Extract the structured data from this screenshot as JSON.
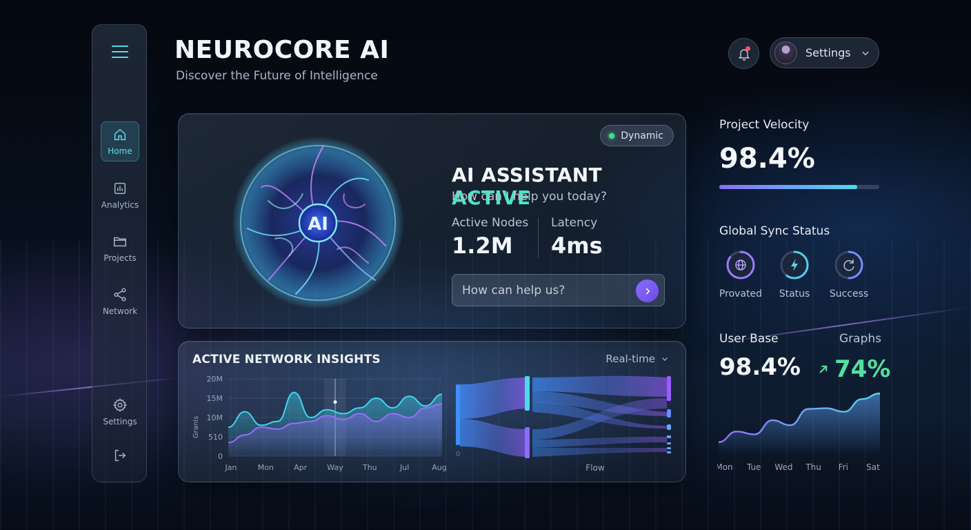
{
  "app": {
    "title": "NEUROCORE AI",
    "subtitle": "Discover the Future of Intelligence"
  },
  "sidebar": {
    "items": [
      {
        "label": "Home",
        "icon": "home-icon",
        "active": true
      },
      {
        "label": "Analytics",
        "icon": "bar-chart-icon",
        "active": false
      },
      {
        "label": "Projects",
        "icon": "folder-icon",
        "active": false
      },
      {
        "label": "Network",
        "icon": "share-nodes-icon",
        "active": false
      },
      {
        "label": "Settings",
        "icon": "gear-icon",
        "active": false
      }
    ],
    "logout_icon": "logout-icon"
  },
  "header": {
    "settings_label": "Settings",
    "bell_icon": "bell-icon",
    "has_notification": true
  },
  "ai_card": {
    "badge": "Dynamic",
    "orb_label": "AI",
    "heading_main": "AI ASSISTANT",
    "heading_accent": "ACTIVE",
    "prompt": "How can I help you today?",
    "stats": [
      {
        "label": "Active Nodes",
        "value": "1.2M"
      },
      {
        "label": "Latency",
        "value": "4ms"
      }
    ],
    "input_placeholder": "How can help us?",
    "accent_color": "#4fe3c2"
  },
  "insights": {
    "title": "ACTIVE NETWORK INSIGHTS",
    "range_label": "Real-time",
    "sankey_label": "Flow",
    "sankey_side_label": "0"
  },
  "chart_data": [
    {
      "type": "area",
      "categories": [
        "Jan",
        "Mon",
        "Apr",
        "Way",
        "Thu",
        "Jul",
        "Aug"
      ],
      "y_ticks": [
        "20M",
        "15M",
        "10M",
        "510",
        "0"
      ],
      "ylabel": "Granis",
      "ylim": [
        0,
        20
      ],
      "series": [
        {
          "values": [
            7.5,
            11.5,
            8,
            9,
            16.5,
            10,
            12,
            11,
            12.5,
            15,
            12.5,
            15.5,
            13,
            16
          ]
        },
        {
          "values": [
            3.5,
            5.5,
            7.5,
            7,
            8.5,
            9,
            10.5,
            9.5,
            11,
            9,
            11,
            10,
            12.5,
            13.5
          ]
        }
      ],
      "highlight_category": "Way",
      "grid": true
    },
    {
      "type": "area",
      "categories": [
        "Mon",
        "Tue",
        "Wed",
        "Thu",
        "Fri",
        "Sat"
      ],
      "title": "User Base",
      "series": [
        {
          "values": [
            1.5,
            3,
            2.6,
            4.6,
            3.9,
            6.2,
            6.3,
            5.8,
            7.6,
            8.4
          ]
        }
      ],
      "grid": false
    }
  ],
  "right_panel": {
    "velocity_label": "Project Velocity",
    "velocity_value": "98.4%",
    "velocity_fraction": 0.86,
    "sync_label": "Global Sync Status",
    "sync_items": [
      {
        "label": "Provated",
        "icon": "globe-icon",
        "progress": 0.85,
        "color": "#9a7bff"
      },
      {
        "label": "Status",
        "icon": "lightning-icon",
        "progress": 0.6,
        "color": "#4fd0f0"
      },
      {
        "label": "Success",
        "icon": "refresh-icon",
        "progress": 0.5,
        "color": "#7a8cff"
      }
    ],
    "userbase_label": "User Base",
    "graphs_label": "Graphs",
    "userbase_value": "98.4%",
    "trend_value": "74%",
    "trend_color": "#4fe3a0"
  }
}
